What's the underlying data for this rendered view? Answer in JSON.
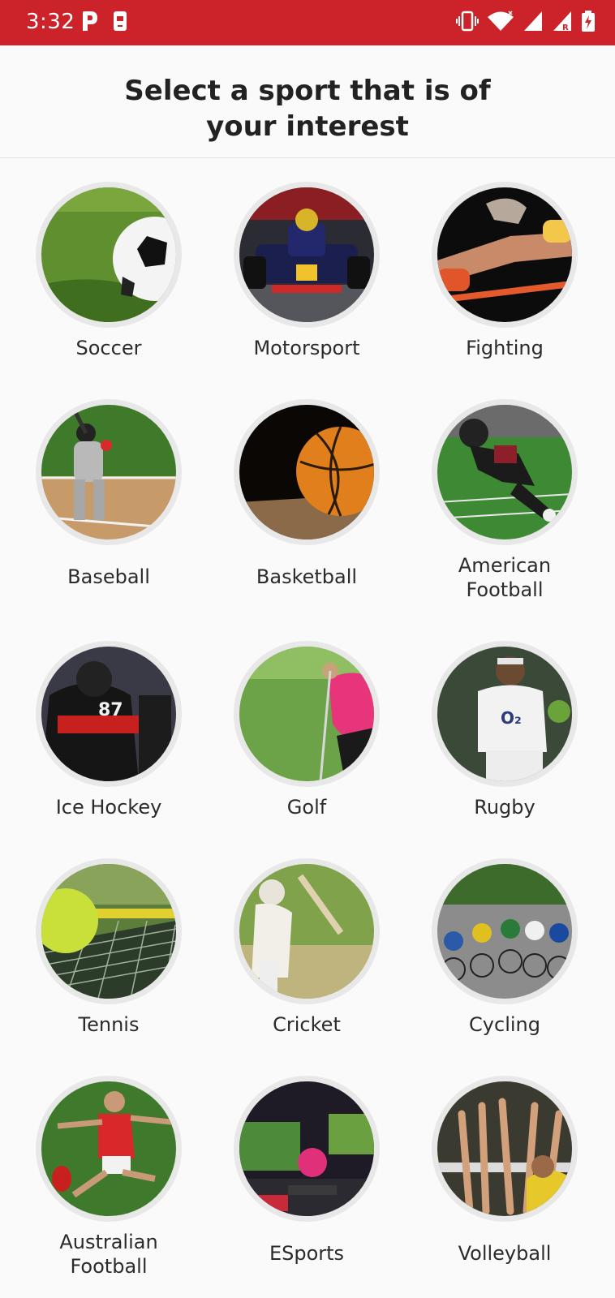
{
  "status_bar": {
    "time": "3:32",
    "background": "#cc2229",
    "icons": [
      "parking-app-icon",
      "phone-notification-icon",
      "vibrate-icon",
      "wifi-icon",
      "signal-icon",
      "roaming-signal-icon",
      "battery-charging-icon"
    ]
  },
  "header": {
    "title_line1": "Select a sport that is of",
    "title_line2": "your interest"
  },
  "sports": [
    {
      "line1": "Soccer",
      "line2": ""
    },
    {
      "line1": "Motorsport",
      "line2": ""
    },
    {
      "line1": "Fighting",
      "line2": ""
    },
    {
      "line1": "Baseball",
      "line2": ""
    },
    {
      "line1": "Basketball",
      "line2": ""
    },
    {
      "line1": "American",
      "line2": "Football"
    },
    {
      "line1": "Ice Hockey",
      "line2": ""
    },
    {
      "line1": "Golf",
      "line2": ""
    },
    {
      "line1": "Rugby",
      "line2": ""
    },
    {
      "line1": "Tennis",
      "line2": ""
    },
    {
      "line1": "Cricket",
      "line2": ""
    },
    {
      "line1": "Cycling",
      "line2": ""
    },
    {
      "line1": "Australian",
      "line2": "Football"
    },
    {
      "line1": "ESports",
      "line2": ""
    },
    {
      "line1": "Volleyball",
      "line2": ""
    }
  ]
}
